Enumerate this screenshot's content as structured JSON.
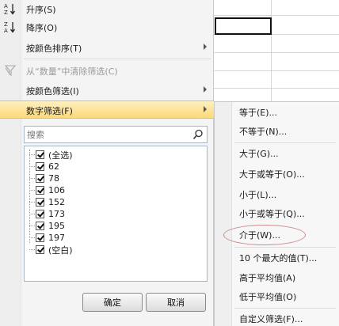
{
  "menu": {
    "sort_asc": "升序(S)",
    "sort_desc": "降序(O)",
    "sort_by_color": "按颜色排序(T)",
    "clear_filter": "从“数量”中清除筛选(C)",
    "filter_by_color": "按颜色筛选(I)",
    "number_filters": "数字筛选(F)"
  },
  "search": {
    "placeholder": "搜索"
  },
  "values": [
    {
      "label": "(全选)",
      "checked": true
    },
    {
      "label": "62",
      "checked": true
    },
    {
      "label": "78",
      "checked": true
    },
    {
      "label": "106",
      "checked": true
    },
    {
      "label": "152",
      "checked": true
    },
    {
      "label": "173",
      "checked": true
    },
    {
      "label": "195",
      "checked": true
    },
    {
      "label": "197",
      "checked": true
    },
    {
      "label": "(空白)",
      "checked": true
    }
  ],
  "buttons": {
    "ok": "确定",
    "cancel": "取消"
  },
  "submenu": [
    "等于(E)...",
    "不等于(N)...",
    "大于(G)...",
    "大于或等于(O)...",
    "小于(L)...",
    "小于或等于(Q)...",
    "介于(W)...",
    "10 个最大的值(T)...",
    "高于平均值(A)",
    "低于平均值(O)",
    "自定义筛选(F)..."
  ],
  "colors": {
    "highlight": "#fbd97a",
    "circle": "#c98a8a"
  }
}
